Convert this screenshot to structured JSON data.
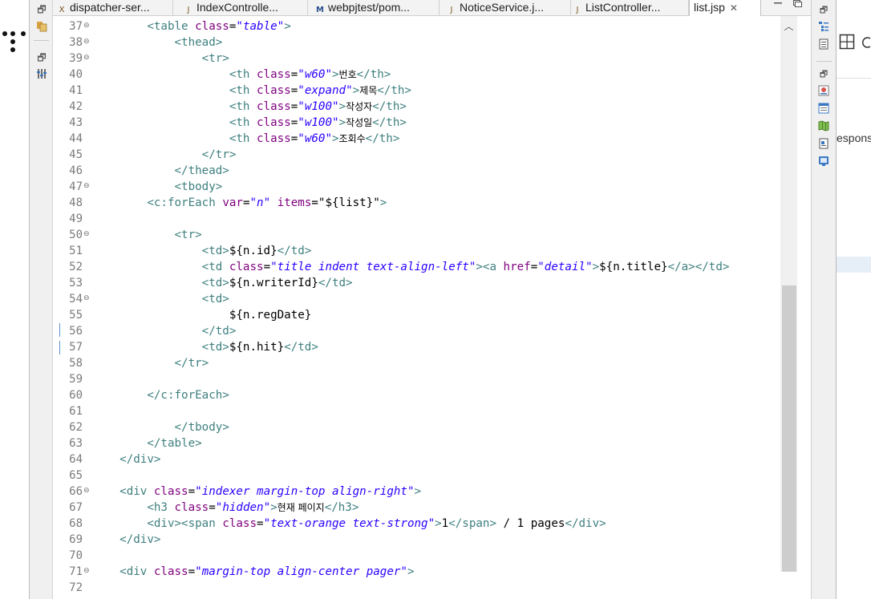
{
  "tabs": [
    {
      "label": "dispatcher-ser...",
      "icon": "xml-file-icon",
      "active": false
    },
    {
      "label": "IndexControlle...",
      "icon": "java-file-icon",
      "active": false
    },
    {
      "label": "webpjtest/pom...",
      "icon": "maven-pom-icon",
      "active": false
    },
    {
      "label": "NoticeService.j...",
      "icon": "java-file-icon",
      "active": false
    },
    {
      "label": "ListController...",
      "icon": "java-file-icon",
      "active": false
    },
    {
      "label": "list.jsp",
      "icon": "jsp-file-icon",
      "active": true,
      "close": "✕"
    }
  ],
  "editor": {
    "line_numbers": [
      "37",
      "38",
      "39",
      "40",
      "41",
      "42",
      "43",
      "44",
      "45",
      "46",
      "47",
      "48",
      "49",
      "50",
      "51",
      "52",
      "53",
      "54",
      "55",
      "56",
      "57",
      "58",
      "59",
      "60",
      "61",
      "62",
      "63",
      "64",
      "65",
      "66",
      "67",
      "68",
      "69",
      "70",
      "71",
      "72"
    ],
    "folding_lines": [
      "37",
      "38",
      "39",
      "47",
      "50",
      "54",
      "66",
      "71"
    ],
    "current_line": "56",
    "code_lines": [
      {
        "indent": "        ",
        "parts": [
          [
            "tag",
            "<table "
          ],
          [
            "attr",
            "class"
          ],
          [
            "",
            "="
          ],
          [
            "val",
            "\"table\""
          ],
          [
            "tag",
            ">"
          ]
        ]
      },
      {
        "indent": "            ",
        "parts": [
          [
            "tag",
            "<thead>"
          ]
        ]
      },
      {
        "indent": "                ",
        "parts": [
          [
            "tag",
            "<tr>"
          ]
        ]
      },
      {
        "indent": "                    ",
        "parts": [
          [
            "tag",
            "<th "
          ],
          [
            "attr",
            "class"
          ],
          [
            "",
            "="
          ],
          [
            "val",
            "\"w60\""
          ],
          [
            "tag",
            ">"
          ],
          [
            "ko",
            "번호"
          ],
          [
            "tag",
            "</th>"
          ]
        ]
      },
      {
        "indent": "                    ",
        "parts": [
          [
            "tag",
            "<th "
          ],
          [
            "attr",
            "class"
          ],
          [
            "",
            "="
          ],
          [
            "val",
            "\"expand\""
          ],
          [
            "tag",
            ">"
          ],
          [
            "ko",
            "제목"
          ],
          [
            "tag",
            "</th>"
          ]
        ]
      },
      {
        "indent": "                    ",
        "parts": [
          [
            "tag",
            "<th "
          ],
          [
            "attr",
            "class"
          ],
          [
            "",
            "="
          ],
          [
            "val",
            "\"w100\""
          ],
          [
            "tag",
            ">"
          ],
          [
            "ko",
            "작성자"
          ],
          [
            "tag",
            "</th>"
          ]
        ]
      },
      {
        "indent": "                    ",
        "parts": [
          [
            "tag",
            "<th "
          ],
          [
            "attr",
            "class"
          ],
          [
            "",
            "="
          ],
          [
            "val",
            "\"w100\""
          ],
          [
            "tag",
            ">"
          ],
          [
            "ko",
            "작성일"
          ],
          [
            "tag",
            "</th>"
          ]
        ]
      },
      {
        "indent": "                    ",
        "parts": [
          [
            "tag",
            "<th "
          ],
          [
            "attr",
            "class"
          ],
          [
            "",
            "="
          ],
          [
            "val",
            "\"w60\""
          ],
          [
            "tag",
            ">"
          ],
          [
            "ko",
            "조회수"
          ],
          [
            "tag",
            "</th>"
          ]
        ]
      },
      {
        "indent": "                ",
        "parts": [
          [
            "tag",
            "</tr>"
          ]
        ]
      },
      {
        "indent": "            ",
        "parts": [
          [
            "tag",
            "</thead>"
          ]
        ]
      },
      {
        "indent": "            ",
        "parts": [
          [
            "tag",
            "<tbody>"
          ]
        ]
      },
      {
        "indent": "        ",
        "parts": [
          [
            "tag",
            "<c:forEach "
          ],
          [
            "attr",
            "var"
          ],
          [
            "",
            "="
          ],
          [
            "val",
            "\"n\""
          ],
          [
            "",
            ""
          ],
          [
            "attr",
            " items"
          ],
          [
            "",
            "=\"${list}\""
          ],
          [
            "tag",
            ">"
          ]
        ]
      },
      {
        "indent": "",
        "parts": []
      },
      {
        "indent": "            ",
        "parts": [
          [
            "tag",
            "<tr>"
          ]
        ]
      },
      {
        "indent": "                ",
        "parts": [
          [
            "tag",
            "<td>"
          ],
          [
            "",
            "${n.id}"
          ],
          [
            "tag",
            "</td>"
          ]
        ]
      },
      {
        "indent": "                ",
        "parts": [
          [
            "tag",
            "<td "
          ],
          [
            "attr",
            "class"
          ],
          [
            "",
            "="
          ],
          [
            "val",
            "\"title indent text-align-left\""
          ],
          [
            "tag",
            ">"
          ],
          [
            "tag",
            "<a "
          ],
          [
            "attr",
            "href"
          ],
          [
            "",
            "="
          ],
          [
            "val",
            "\"detail\""
          ],
          [
            "tag",
            ">"
          ],
          [
            "",
            "${n.title}"
          ],
          [
            "tag",
            "</a></td>"
          ]
        ]
      },
      {
        "indent": "                ",
        "parts": [
          [
            "tag",
            "<td>"
          ],
          [
            "",
            "${n.writerId}"
          ],
          [
            "tag",
            "</td>"
          ]
        ]
      },
      {
        "indent": "                ",
        "parts": [
          [
            "tag",
            "<td>"
          ]
        ]
      },
      {
        "indent": "                    ",
        "parts": [
          [
            "",
            "${n.regDate}"
          ]
        ]
      },
      {
        "indent": "                ",
        "parts": [
          [
            "tag",
            "</td>"
          ]
        ]
      },
      {
        "indent": "                ",
        "parts": [
          [
            "tag",
            "<td>"
          ],
          [
            "",
            "${n.hit}"
          ],
          [
            "tag",
            "</td>"
          ]
        ]
      },
      {
        "indent": "            ",
        "parts": [
          [
            "tag",
            "</tr>"
          ]
        ]
      },
      {
        "indent": "",
        "parts": []
      },
      {
        "indent": "        ",
        "parts": [
          [
            "tag",
            "</c:forEach>"
          ]
        ]
      },
      {
        "indent": "",
        "parts": []
      },
      {
        "indent": "            ",
        "parts": [
          [
            "tag",
            "</tbody>"
          ]
        ]
      },
      {
        "indent": "        ",
        "parts": [
          [
            "tag",
            "</table>"
          ]
        ]
      },
      {
        "indent": "    ",
        "parts": [
          [
            "tag",
            "</div>"
          ]
        ]
      },
      {
        "indent": "",
        "parts": []
      },
      {
        "indent": "    ",
        "parts": [
          [
            "tag",
            "<div "
          ],
          [
            "attr",
            "class"
          ],
          [
            "",
            "="
          ],
          [
            "val",
            "\"indexer margin-top align-right\""
          ],
          [
            "tag",
            ">"
          ]
        ]
      },
      {
        "indent": "        ",
        "parts": [
          [
            "tag",
            "<h3 "
          ],
          [
            "attr",
            "class"
          ],
          [
            "",
            "="
          ],
          [
            "val",
            "\"hidden\""
          ],
          [
            "tag",
            ">"
          ],
          [
            "ko",
            "현재 페이지"
          ],
          [
            "tag",
            "</h3>"
          ]
        ]
      },
      {
        "indent": "        ",
        "parts": [
          [
            "tag",
            "<div><span "
          ],
          [
            "attr",
            "class"
          ],
          [
            "",
            "="
          ],
          [
            "val",
            "\"text-orange text-strong\""
          ],
          [
            "tag",
            ">"
          ],
          [
            "",
            "1"
          ],
          [
            "tag",
            "</span>"
          ],
          [
            "",
            " / 1 pages"
          ],
          [
            "tag",
            "</div>"
          ]
        ]
      },
      {
        "indent": "    ",
        "parts": [
          [
            "tag",
            "</div>"
          ]
        ]
      },
      {
        "indent": "",
        "parts": []
      },
      {
        "indent": "    ",
        "parts": [
          [
            "tag",
            "<div "
          ],
          [
            "attr",
            "class"
          ],
          [
            "",
            "="
          ],
          [
            "val",
            "\"margin-top align-center pager\""
          ],
          [
            "tag",
            ">"
          ]
        ]
      },
      {
        "indent": "",
        "parts": []
      }
    ]
  },
  "far_right": {
    "partial_text": "espons"
  },
  "colors": {
    "tag": "#3f7f7f",
    "attr": "#7f007f",
    "value": "#2a00ff",
    "current_line": "#e8f2fe",
    "quick_diff": "#5b8fc7"
  }
}
